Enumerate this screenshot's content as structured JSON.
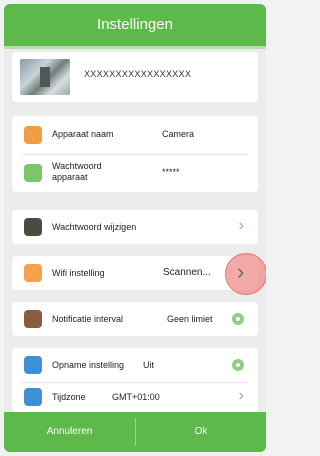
{
  "header": {
    "title": "Instellingen"
  },
  "device": {
    "id": "XXXXXXXXXXXXXXXXX"
  },
  "settings": {
    "name_label": "Apparaat naam",
    "name_value": "Camera",
    "password_label": "Wachtwoord apparaat",
    "password_value": "*****",
    "change_password": "Wachtwoord wijzigen",
    "wifi_label": "Wifi instelling",
    "wifi_value": "Scannen...",
    "notify_label": "Notificatie interval",
    "notify_value": "Geen limiet",
    "record_label": "Opname instelling",
    "record_value": "Uit",
    "timezone_label": "Tijdzone",
    "timezone_value": "GMT+01:00"
  },
  "footer": {
    "left": "Annuleren",
    "right": "Ok"
  },
  "colors": {
    "accent": "#5db94a"
  }
}
